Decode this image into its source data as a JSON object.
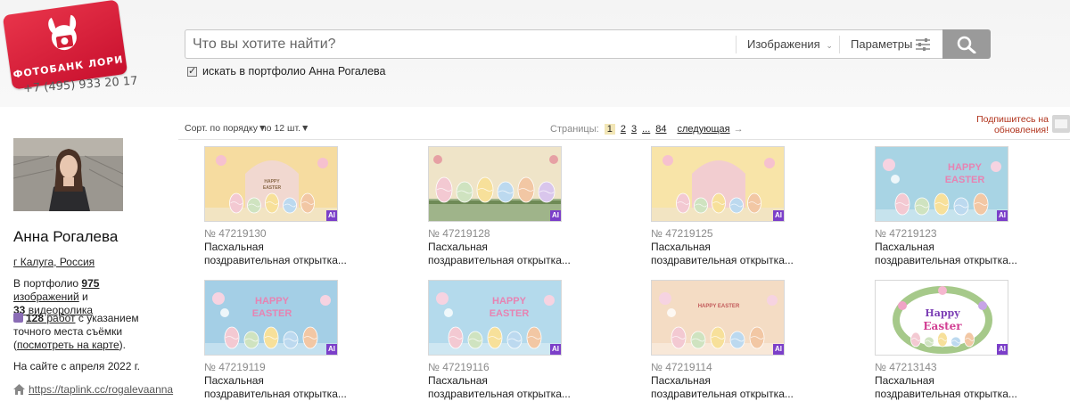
{
  "header": {
    "logo_text": "ФОТОБАНК ЛОРИ",
    "phone": "+7 (495) 933 20 17",
    "search_placeholder": "Что вы хотите найти?",
    "search_type": "Изображения",
    "params_label": "Параметры",
    "portfolio_checkbox_label": "искать в портфолио Анна Рогалева"
  },
  "author": {
    "name": "Анна Рогалева",
    "location": "г Калуга, Россия",
    "portfolio_prefix": "В портфолио",
    "images_count": "975",
    "images_word": "изображений",
    "and": "и",
    "videos_count": "33",
    "videos_word": "видеоролика",
    "geo_count": "128",
    "geo_word": "работ",
    "geo_text": "с указанием точного места съёмки",
    "map_link": "посмотреть на карте",
    "since": "На сайте с апреля 2022 г.",
    "site_link": "https://taplink.cc/rogalevaanna"
  },
  "toolbar": {
    "sort_label": "Сорт. по порядку▼",
    "count_label": "по 12 шт.▼",
    "pages_label": "Страницы:",
    "pages": [
      "1",
      "2",
      "3",
      "...",
      "84"
    ],
    "next_label": "следующая",
    "next_arrow": "→",
    "subscribe": "Подпишитесь на обновления!"
  },
  "items": [
    {
      "id": "№ 47219130",
      "title1": "Пасхальная",
      "title2": "поздравительная открытка...",
      "ai": "AI",
      "bg": "#f6dca0",
      "variant": "arch"
    },
    {
      "id": "№ 47219128",
      "title1": "Пасхальная",
      "title2": "поздравительная открытка...",
      "ai": "AI",
      "bg": "#efe4c8",
      "variant": "row"
    },
    {
      "id": "№ 47219125",
      "title1": "Пасхальная",
      "title2": "поздравительная открытка...",
      "ai": "AI",
      "bg": "#f8e4a8",
      "variant": "arch-pink"
    },
    {
      "id": "№ 47219123",
      "title1": "Пасхальная",
      "title2": "поздравительная открытка...",
      "ai": "AI",
      "bg": "#a8d4e4",
      "variant": "happy"
    },
    {
      "id": "№ 47219119",
      "title1": "Пасхальная",
      "title2": "поздравительная открытка...",
      "ai": "AI",
      "bg": "#a4cfe6",
      "variant": "happy"
    },
    {
      "id": "№ 47219116",
      "title1": "Пасхальная",
      "title2": "поздравительная открытка...",
      "ai": "AI",
      "bg": "#b4daec",
      "variant": "happy"
    },
    {
      "id": "№ 47219114",
      "title1": "Пасхальная",
      "title2": "поздравительная открытка...",
      "ai": "AI",
      "bg": "#f4dcc4",
      "variant": "happy-warm"
    },
    {
      "id": "№ 47213143",
      "title1": "Пасхальная",
      "title2": "поздравительная открытка...",
      "ai": "AI",
      "bg": "#ffffff",
      "variant": "wreath"
    }
  ],
  "thumb_texts": {
    "happy": "HAPPY",
    "easter": "EASTER",
    "happy_cursive": "Happy",
    "easter_cursive": "Easter",
    "happy_easter_small": "HAPPY EASTER"
  }
}
